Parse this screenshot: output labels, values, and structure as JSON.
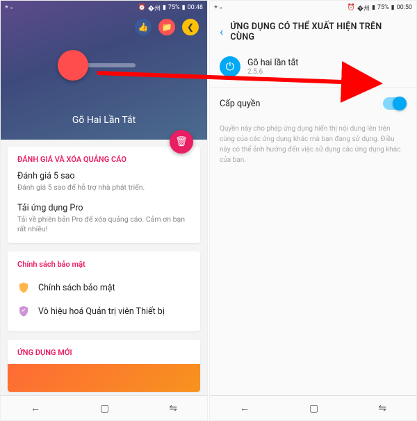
{
  "statusbar": {
    "battery": "75%",
    "time_left": "00:48",
    "time_right": "00:50"
  },
  "left": {
    "hero_title": "Gõ Hai Lần Tắt",
    "section_rating": {
      "title": "ĐÁNH GIÁ VÀ XÓA QUẢNG CÁO",
      "rate_title": "Đánh giá 5 sao",
      "rate_sub": "Đánh giá 5 sao để hỗ trợ nhà phát triển.",
      "pro_title": "Tải ứng dụng Pro",
      "pro_sub": "Tải về phiên bản Pro để xóa quảng cáo. Cảm ơn bạn rất nhiều!"
    },
    "section_privacy": {
      "title": "Chính sách bảo mật",
      "row1": "Chính sách bảo mật",
      "row2": "Vô hiệu hoá Quản trị viên Thiết bị"
    },
    "section_new": {
      "title": "ỨNG DỤNG MỚI"
    }
  },
  "right": {
    "header_title": "ỨNG DỤNG CÓ THỂ XUẤT HIỆN TRÊN CÙNG",
    "app_name": "Gõ hai lần tắt",
    "app_version": "2.5.6",
    "perm_label": "Cấp quyền",
    "perm_desc": "Quyền này cho phép ứng dụng hiển thị nội dung lên trên cùng của các ứng dụng khác mà bạn đang sử dụng. Điều này có thể ảnh hưởng đến việc sử dụng các ứng dụng khác của bạn."
  },
  "icons": {
    "thumb": "👍",
    "folder": "📁",
    "share": "❮",
    "trash": "🗑",
    "power": "⏻",
    "back": "←",
    "home": "▢",
    "recent": "⇋"
  }
}
